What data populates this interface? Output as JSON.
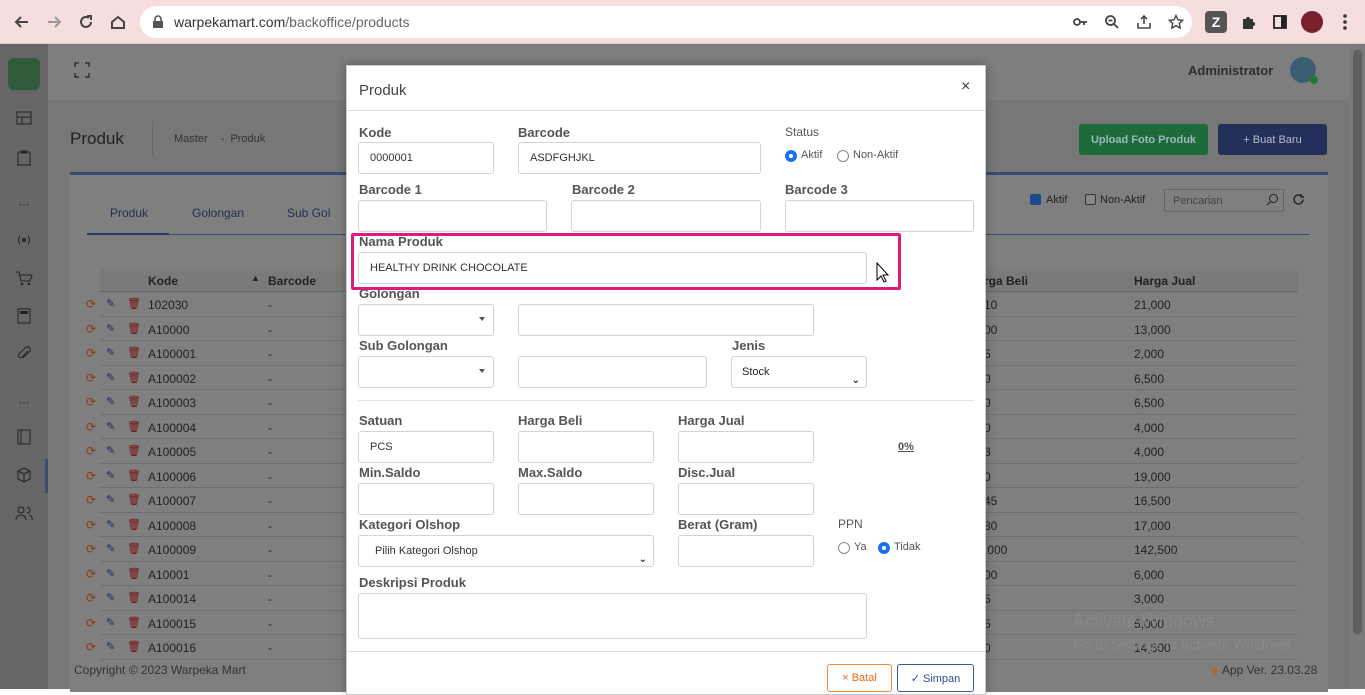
{
  "browser": {
    "url_host": "warpekamart.com",
    "url_path": "/backoffice/products"
  },
  "header": {
    "user_name": "Administrator"
  },
  "page": {
    "title": "Produk",
    "breadcrumb_1": "Master",
    "breadcrumb_sep": "-",
    "breadcrumb_2": "Produk",
    "upload_button": "Upload Foto Produk",
    "create_button": "+ Buat Baru",
    "tabs": [
      "Produk",
      "Golongan",
      "Sub Gol"
    ],
    "filter_active": "Aktif",
    "filter_inactive": "Non-Aktif",
    "search_placeholder": "Pencarian"
  },
  "table": {
    "headers": {
      "kode": "Kode",
      "barcode": "Barcode",
      "harga_beli": "rga Beli",
      "harga_jual": "Harga Jual"
    },
    "rows": [
      {
        "kode": "102030",
        "barcode": "-",
        "beli": "10",
        "jual": "21,000"
      },
      {
        "kode": "A10000",
        "barcode": "-",
        "beli": "00",
        "jual": "13,000"
      },
      {
        "kode": "A100001",
        "barcode": "-",
        "beli": "5",
        "jual": "2,000"
      },
      {
        "kode": "A100002",
        "barcode": "-",
        "beli": "0",
        "jual": "6,500"
      },
      {
        "kode": "A100003",
        "barcode": "-",
        "beli": "0",
        "jual": "6,500"
      },
      {
        "kode": "A100004",
        "barcode": "-",
        "beli": "0",
        "jual": "4,000"
      },
      {
        "kode": "A100005",
        "barcode": "-",
        "beli": "3",
        "jual": "4,000"
      },
      {
        "kode": "A100006",
        "barcode": "-",
        "beli": "0",
        "jual": "19,000"
      },
      {
        "kode": "A100007",
        "barcode": "-",
        "beli": "45",
        "jual": "16,500"
      },
      {
        "kode": "A100008",
        "barcode": "-",
        "beli": "80",
        "jual": "17,000"
      },
      {
        "kode": "A100009",
        "barcode": "-",
        "beli": ",000",
        "jual": "142,500"
      },
      {
        "kode": "A10001",
        "barcode": "-",
        "beli": "00",
        "jual": "6,000"
      },
      {
        "kode": "A100014",
        "barcode": "-",
        "beli": "5",
        "jual": "3,000"
      },
      {
        "kode": "A100015",
        "barcode": "-",
        "beli": "5",
        "jual": "5,000"
      },
      {
        "kode": "A100016",
        "barcode": "-",
        "beli": "0",
        "jual": "14,500"
      }
    ]
  },
  "footer": {
    "copyright": "Copyright © 2023 Warpeka Mart",
    "version": "App Ver. 23.03.28"
  },
  "watermark": {
    "line1": "Activate Windows",
    "line2": "Go to Settings to activate Windows."
  },
  "modal": {
    "title": "Produk",
    "close": "×",
    "kode_label": "Kode",
    "kode_value": "0000001",
    "barcode_label": "Barcode",
    "barcode_value": "ASDFGHJKL",
    "status_label": "Status",
    "status_active": "Aktif",
    "status_inactive": "Non-Aktif",
    "barcode1_label": "Barcode 1",
    "barcode2_label": "Barcode 2",
    "barcode3_label": "Barcode 3",
    "nama_label": "Nama Produk",
    "nama_value": "HEALTHY DRINK CHOCOLATE",
    "golongan_label": "Golongan",
    "subgol_label": "Sub Golongan",
    "jenis_label": "Jenis",
    "jenis_value": "Stock",
    "satuan_label": "Satuan",
    "satuan_value": "PCS",
    "harga_beli_label": "Harga Beli",
    "harga_jual_label": "Harga Jual",
    "margin_value": "0%",
    "min_saldo_label": "Min.Saldo",
    "max_saldo_label": "Max.Saldo",
    "disc_label": "Disc.Jual",
    "kategori_label": "Kategori Olshop",
    "kategori_value": "Pilih Kategori Olshop",
    "berat_label": "Berat (Gram)",
    "ppn_label": "PPN",
    "ppn_yes": "Ya",
    "ppn_no": "Tidak",
    "deskripsi_label": "Deskripsi Produk",
    "cancel_button": "× Batal",
    "save_button": "✓ Simpan"
  }
}
